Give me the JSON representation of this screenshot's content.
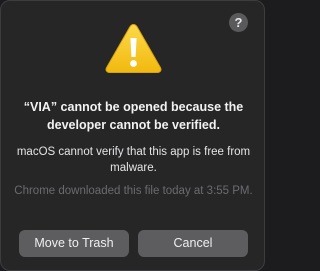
{
  "dialog": {
    "help_label": "?",
    "icon": "warning-triangle-icon",
    "title": "“VIA” cannot be opened because the developer cannot be verified.",
    "message": "macOS cannot verify that this app is free from malware.",
    "info": "Chrome downloaded this file today at 3:55 PM.",
    "buttons": {
      "trash_label": "Move to Trash",
      "cancel_label": "Cancel"
    }
  },
  "colors": {
    "background": "#262627",
    "warning_yellow": "#f6c71c",
    "button": "#5d5d60"
  }
}
